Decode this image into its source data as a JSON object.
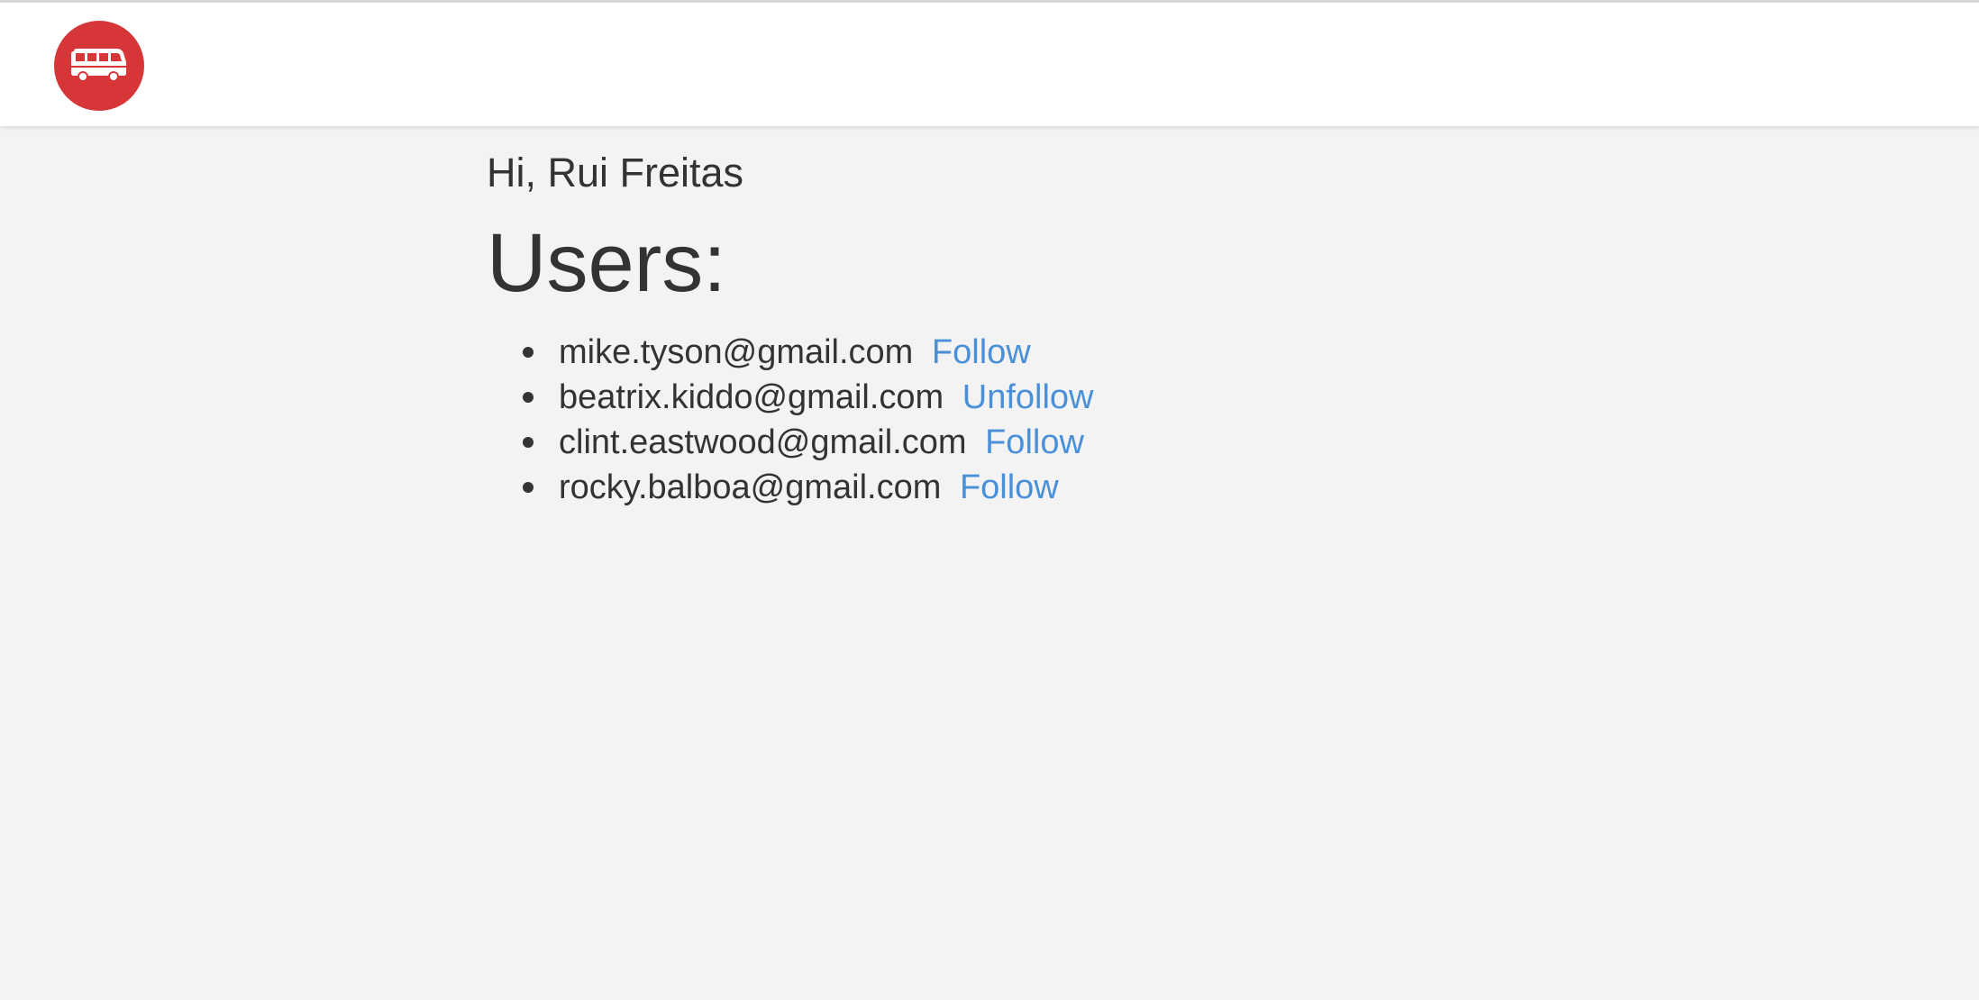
{
  "header": {
    "logo_icon": "bus-icon",
    "logo_color": "#d63638"
  },
  "main": {
    "greeting": "Hi, Rui Freitas",
    "heading": "Users:",
    "users": [
      {
        "email": "mike.tyson@gmail.com",
        "action": "Follow"
      },
      {
        "email": "beatrix.kiddo@gmail.com",
        "action": "Unfollow"
      },
      {
        "email": "clint.eastwood@gmail.com",
        "action": "Follow"
      },
      {
        "email": "rocky.balboa@gmail.com",
        "action": "Follow"
      }
    ]
  },
  "colors": {
    "link": "#4a90d9",
    "text": "#333333",
    "background": "#f3f3f3"
  }
}
